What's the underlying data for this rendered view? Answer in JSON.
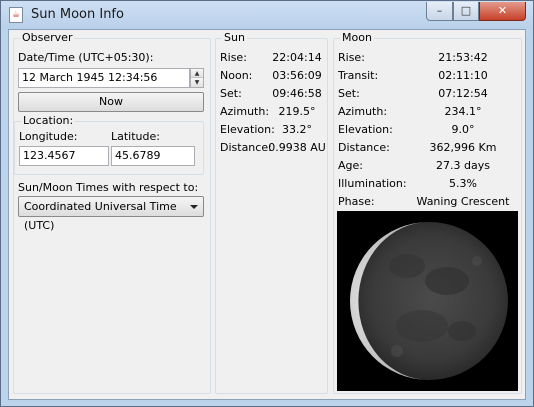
{
  "window": {
    "title": "Sun Moon Info",
    "minimize_symbol": "–",
    "maximize_symbol": "□",
    "close_symbol": "✕"
  },
  "observer": {
    "group_label": "Observer",
    "datetime_label": "Date/Time (UTC+05:30):",
    "datetime_value": "12 March 1945 12:34:56",
    "now_button": "Now",
    "location_label": "Location:",
    "longitude_label": "Longitude:",
    "latitude_label": "Latitude:",
    "longitude_value": "123.4567",
    "latitude_value": "45.6789",
    "times_label": "Sun/Moon Times with respect to:",
    "times_selected": "Coordinated Universal Time (UTC)"
  },
  "sun": {
    "group_label": "Sun",
    "rows": [
      {
        "label": "Rise:",
        "value": "22:04:14"
      },
      {
        "label": "Noon:",
        "value": "03:56:09"
      },
      {
        "label": "Set:",
        "value": "09:46:58"
      },
      {
        "label": "Azimuth:",
        "value": "219.5°"
      },
      {
        "label": "Elevation:",
        "value": "33.2°"
      },
      {
        "label": "Distance:",
        "value": "0.9938 AU"
      }
    ]
  },
  "moon": {
    "group_label": "Moon",
    "rows": [
      {
        "label": "Rise:",
        "value": "21:53:42"
      },
      {
        "label": "Transit:",
        "value": "02:11:10"
      },
      {
        "label": "Set:",
        "value": "07:12:54"
      },
      {
        "label": "Azimuth:",
        "value": "234.1°"
      },
      {
        "label": "Elevation:",
        "value": "9.0°"
      },
      {
        "label": "Distance:",
        "value": "362,996 Km"
      },
      {
        "label": "Age:",
        "value": "27.3 days"
      },
      {
        "label": "Illumination:",
        "value": "5.3%"
      },
      {
        "label": "Phase:",
        "value": "Waning Crescent"
      }
    ],
    "illumination_fraction": 0.053
  },
  "colors": {
    "window_frame": "#bcd3ec",
    "client_bg": "#f0f0f0",
    "close_button": "#c7412a",
    "moon_bg": "#000000"
  },
  "icons": [
    "app-icon",
    "minimize-icon",
    "maximize-icon",
    "close-icon",
    "spin-up-icon",
    "spin-down-icon",
    "dropdown-arrow-icon"
  ]
}
